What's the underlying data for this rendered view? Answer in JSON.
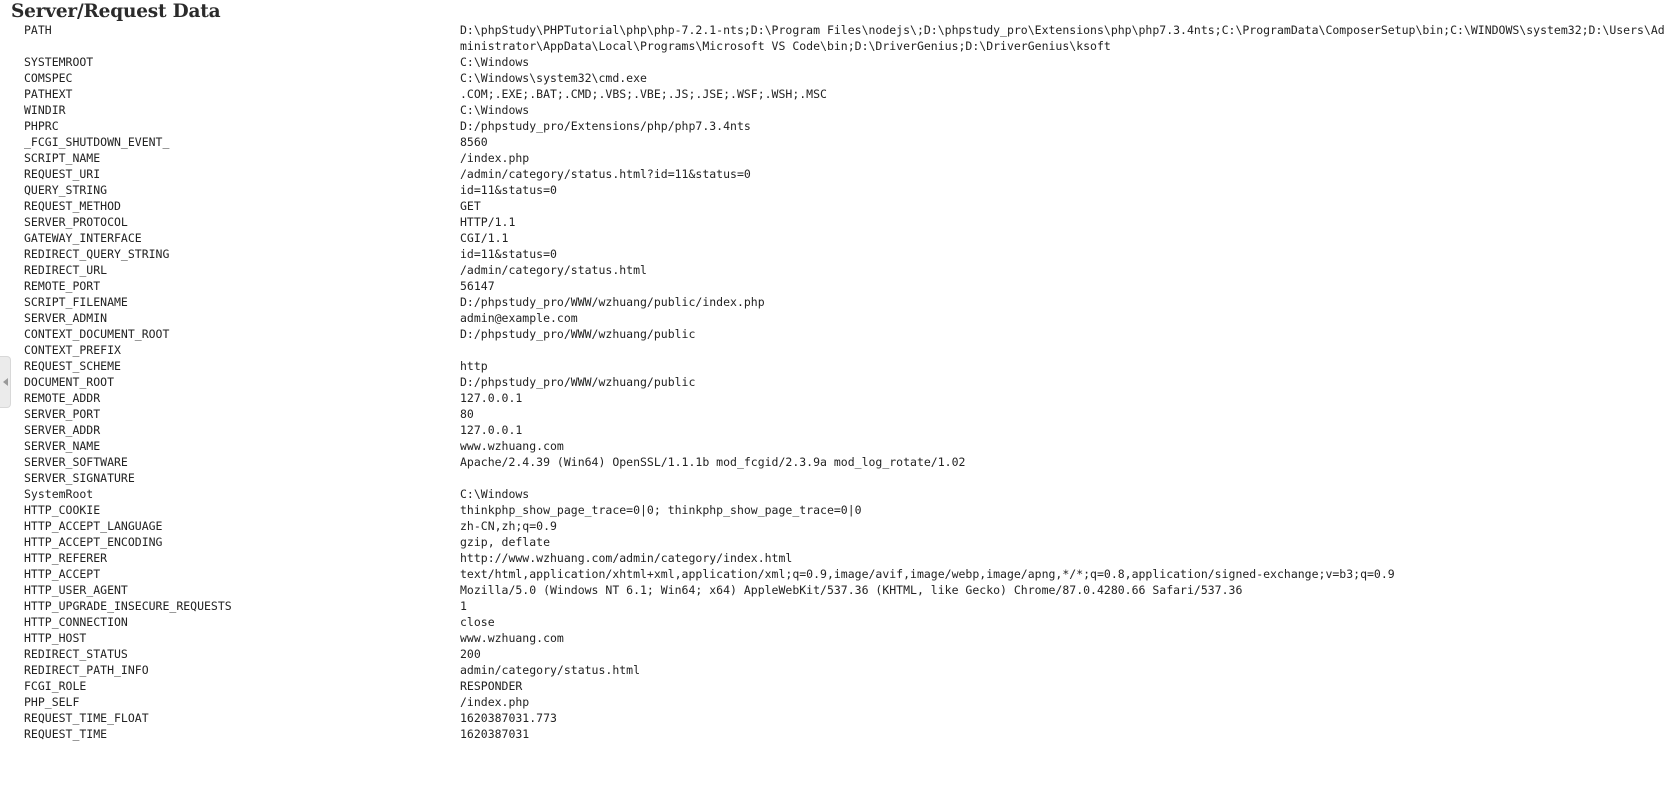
{
  "page": {
    "title": "Server/Request Data",
    "panel_toggle_icon": "chevron-left-icon"
  },
  "rows": [
    {
      "key": "PATH",
      "value": "D:\\phpStudy\\PHPTutorial\\php\\php-7.2.1-nts;D:\\Program Files\\nodejs\\;D:\\phpstudy_pro\\Extensions\\php\\php7.3.4nts;C:\\ProgramData\\ComposerSetup\\bin;C:\\WINDOWS\\system32;D:\\Users\\Administrator\\AppData\\Local\\Programs\\Microsoft VS Code\\bin;D:\\DriverGenius;D:\\DriverGenius\\ksoft",
      "tall": true
    },
    {
      "key": "SYSTEMROOT",
      "value": "C:\\Windows"
    },
    {
      "key": "COMSPEC",
      "value": "C:\\Windows\\system32\\cmd.exe"
    },
    {
      "key": "PATHEXT",
      "value": ".COM;.EXE;.BAT;.CMD;.VBS;.VBE;.JS;.JSE;.WSF;.WSH;.MSC"
    },
    {
      "key": "WINDIR",
      "value": "C:\\Windows"
    },
    {
      "key": "PHPRC",
      "value": "D:/phpstudy_pro/Extensions/php/php7.3.4nts"
    },
    {
      "key": "_FCGI_SHUTDOWN_EVENT_",
      "value": "8560"
    },
    {
      "key": "SCRIPT_NAME",
      "value": "/index.php"
    },
    {
      "key": "REQUEST_URI",
      "value": "/admin/category/status.html?id=11&status=0"
    },
    {
      "key": "QUERY_STRING",
      "value": "id=11&status=0"
    },
    {
      "key": "REQUEST_METHOD",
      "value": "GET"
    },
    {
      "key": "SERVER_PROTOCOL",
      "value": "HTTP/1.1"
    },
    {
      "key": "GATEWAY_INTERFACE",
      "value": "CGI/1.1"
    },
    {
      "key": "REDIRECT_QUERY_STRING",
      "value": "id=11&status=0"
    },
    {
      "key": "REDIRECT_URL",
      "value": "/admin/category/status.html"
    },
    {
      "key": "REMOTE_PORT",
      "value": "56147"
    },
    {
      "key": "SCRIPT_FILENAME",
      "value": "D:/phpstudy_pro/WWW/wzhuang/public/index.php"
    },
    {
      "key": "SERVER_ADMIN",
      "value": "admin@example.com"
    },
    {
      "key": "CONTEXT_DOCUMENT_ROOT",
      "value": "D:/phpstudy_pro/WWW/wzhuang/public"
    },
    {
      "key": "CONTEXT_PREFIX",
      "value": ""
    },
    {
      "key": "REQUEST_SCHEME",
      "value": "http"
    },
    {
      "key": "DOCUMENT_ROOT",
      "value": "D:/phpstudy_pro/WWW/wzhuang/public"
    },
    {
      "key": "REMOTE_ADDR",
      "value": "127.0.0.1"
    },
    {
      "key": "SERVER_PORT",
      "value": "80"
    },
    {
      "key": "SERVER_ADDR",
      "value": "127.0.0.1"
    },
    {
      "key": "SERVER_NAME",
      "value": "www.wzhuang.com"
    },
    {
      "key": "SERVER_SOFTWARE",
      "value": "Apache/2.4.39 (Win64) OpenSSL/1.1.1b mod_fcgid/2.3.9a mod_log_rotate/1.02"
    },
    {
      "key": "SERVER_SIGNATURE",
      "value": ""
    },
    {
      "key": "SystemRoot",
      "value": "C:\\Windows"
    },
    {
      "key": "HTTP_COOKIE",
      "value": "thinkphp_show_page_trace=0|0; thinkphp_show_page_trace=0|0"
    },
    {
      "key": "HTTP_ACCEPT_LANGUAGE",
      "value": "zh-CN,zh;q=0.9"
    },
    {
      "key": "HTTP_ACCEPT_ENCODING",
      "value": "gzip, deflate"
    },
    {
      "key": "HTTP_REFERER",
      "value": "http://www.wzhuang.com/admin/category/index.html"
    },
    {
      "key": "HTTP_ACCEPT",
      "value": "text/html,application/xhtml+xml,application/xml;q=0.9,image/avif,image/webp,image/apng,*/*;q=0.8,application/signed-exchange;v=b3;q=0.9"
    },
    {
      "key": "HTTP_USER_AGENT",
      "value": "Mozilla/5.0 (Windows NT 6.1; Win64; x64) AppleWebKit/537.36 (KHTML, like Gecko) Chrome/87.0.4280.66 Safari/537.36"
    },
    {
      "key": "HTTP_UPGRADE_INSECURE_REQUESTS",
      "value": "1"
    },
    {
      "key": "HTTP_CONNECTION",
      "value": "close"
    },
    {
      "key": "HTTP_HOST",
      "value": "www.wzhuang.com"
    },
    {
      "key": "REDIRECT_STATUS",
      "value": "200"
    },
    {
      "key": "REDIRECT_PATH_INFO",
      "value": "admin/category/status.html"
    },
    {
      "key": "FCGI_ROLE",
      "value": "RESPONDER"
    },
    {
      "key": "PHP_SELF",
      "value": "/index.php"
    },
    {
      "key": "REQUEST_TIME_FLOAT",
      "value": "1620387031.773"
    },
    {
      "key": "REQUEST_TIME",
      "value": "1620387031"
    }
  ]
}
